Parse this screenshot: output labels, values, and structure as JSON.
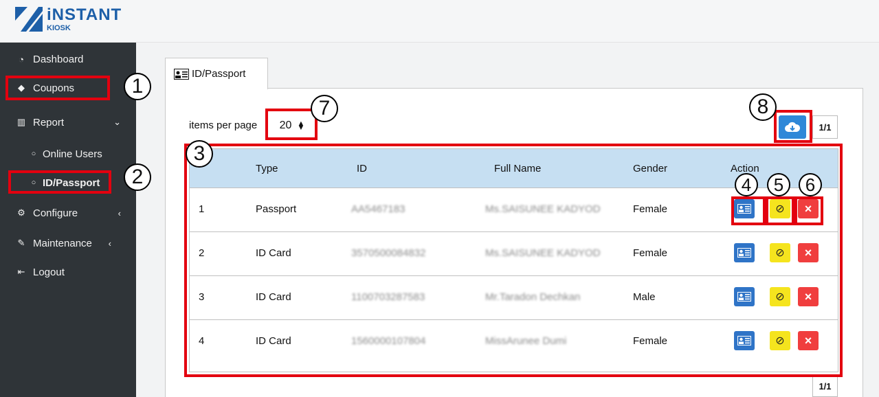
{
  "app": {
    "logo_line1": "iNSTANT",
    "logo_line2": "KIOSK",
    "brand_color": "#1d5fa8",
    "sidebar_bg": "#2f3438"
  },
  "sidebar": {
    "dashboard": {
      "label": "Dashboard",
      "icon": "gauge-icon"
    },
    "coupons": {
      "label": "Coupons",
      "icon": "tag-icon"
    },
    "report": {
      "label": "Report",
      "icon": "bar-chart-icon",
      "expanded": true
    },
    "online_users": {
      "label": "Online Users"
    },
    "id_passport": {
      "label": "ID/Passport"
    },
    "configure": {
      "label": "Configure",
      "icon": "gear-icon"
    },
    "maintenance": {
      "label": "Maintenance",
      "icon": "wrench-icon"
    },
    "logout": {
      "label": "Logout",
      "icon": "logout-icon"
    }
  },
  "tab": {
    "label": "ID/Passport",
    "icon": "id-card-icon"
  },
  "toolbar": {
    "items_per_page_label": "items per page",
    "items_per_page_value": "20",
    "download_icon": "cloud-download-icon",
    "page_indicator": "1/1"
  },
  "table": {
    "header_bg": "#c6dff2",
    "columns": [
      "",
      "Type",
      "ID",
      "Full Name",
      "Gender",
      "Action"
    ],
    "rows": [
      {
        "no": "1",
        "type": "Passport",
        "id": "AA5467183",
        "name": "Ms.SAISUNEE KADYOD",
        "gender": "Female"
      },
      {
        "no": "2",
        "type": "ID Card",
        "id": "3570500084832",
        "name": "Ms.SAISUNEE KADYOD",
        "gender": "Female"
      },
      {
        "no": "3",
        "type": "ID Card",
        "id": "1100703287583",
        "name": "Mr.Taradon Dechkan",
        "gender": "Male"
      },
      {
        "no": "4",
        "type": "ID Card",
        "id": "1560000107804",
        "name": "MissArunee Dumi",
        "gender": "Female"
      }
    ],
    "actions": {
      "view": "id-card-icon",
      "suspend": "ban-icon",
      "delete": "close-icon"
    }
  },
  "pagination_bottom": "1/1",
  "annotations": [
    "1",
    "2",
    "3",
    "4",
    "5",
    "6",
    "7",
    "8"
  ],
  "annotation_color": "#e3000f"
}
